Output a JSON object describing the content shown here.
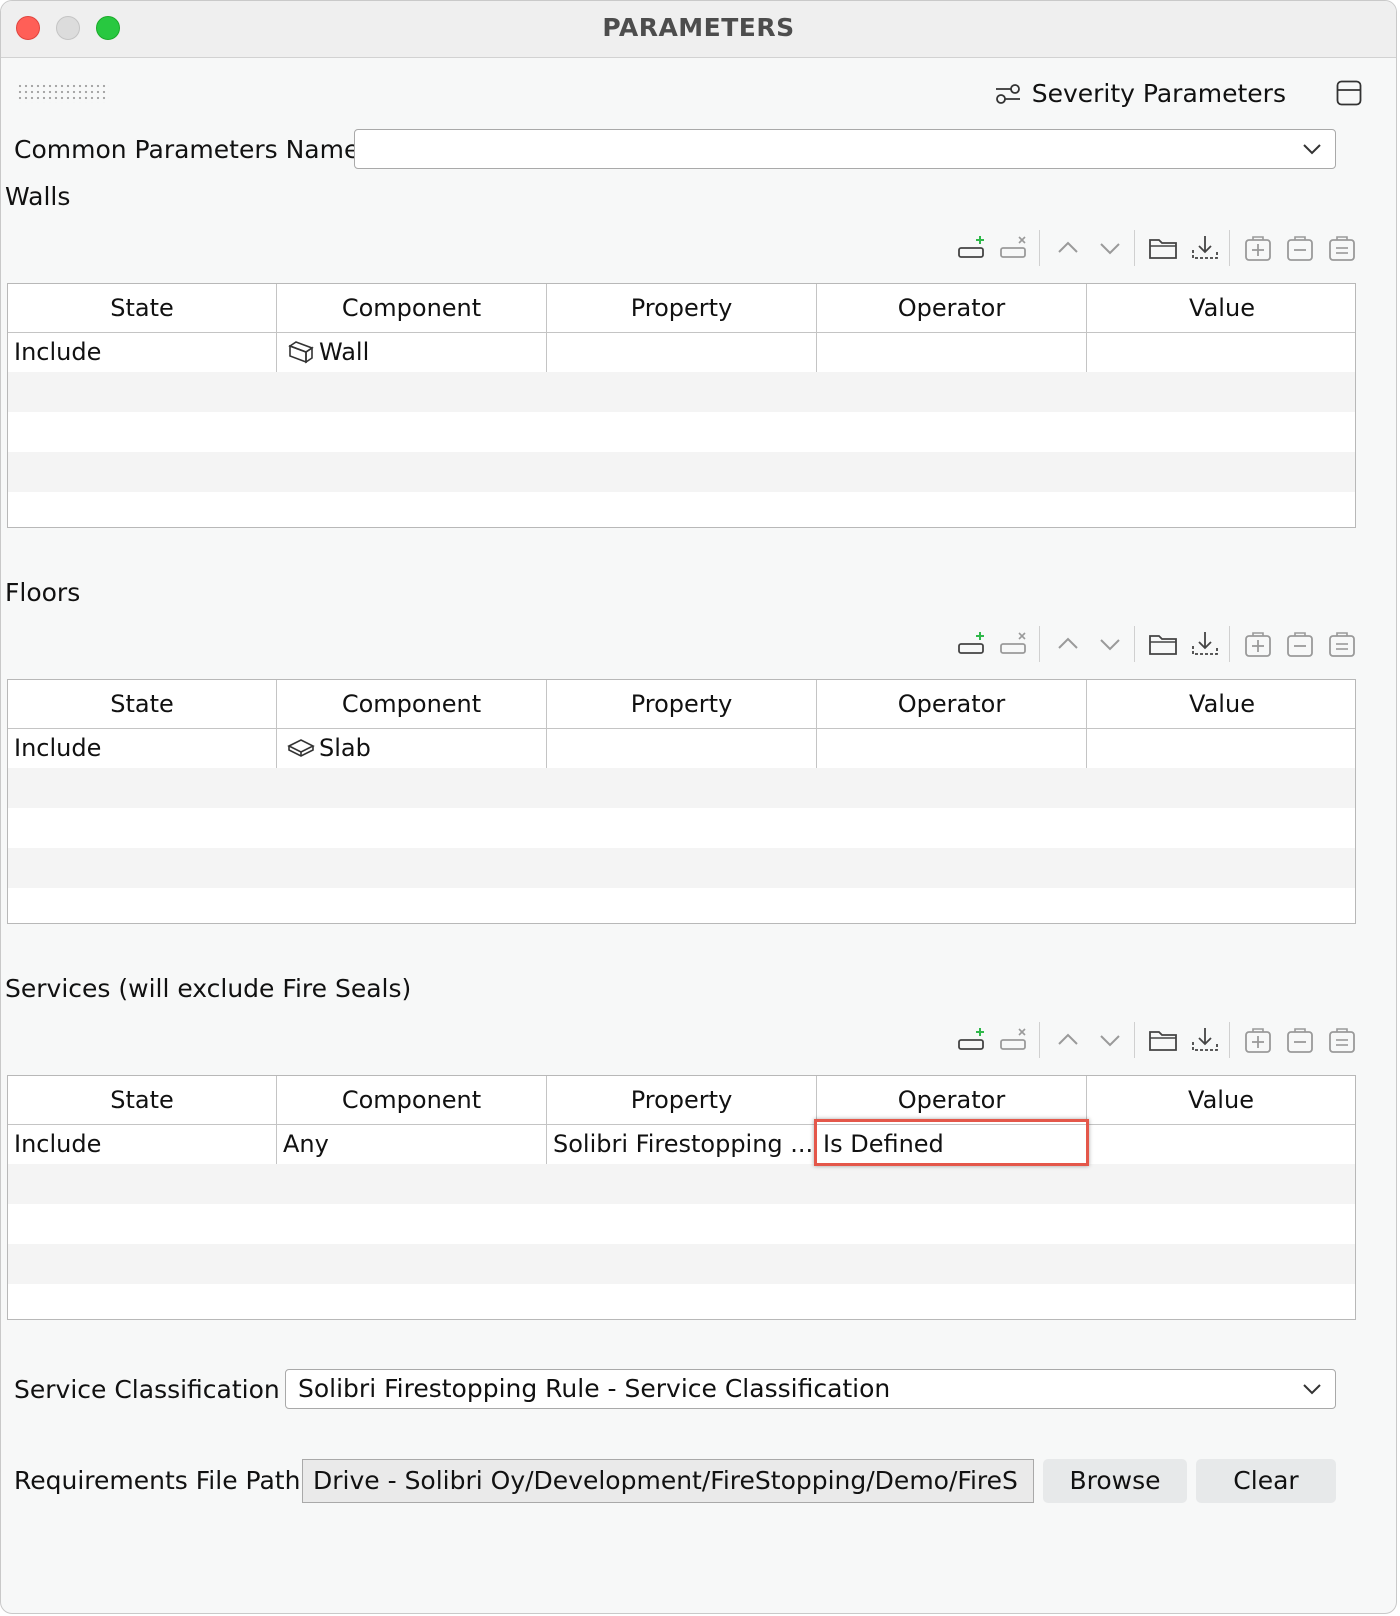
{
  "window": {
    "title": "PARAMETERS"
  },
  "header": {
    "severity_label": "Severity Parameters",
    "severity_icon": "sliders-icon",
    "panel_icon": "panel-toggle-icon"
  },
  "common": {
    "label": "Common Parameters Name",
    "value": ""
  },
  "columns": [
    "State",
    "Component",
    "Property",
    "Operator",
    "Value"
  ],
  "toolbar_icons": [
    "add-row-icon",
    "remove-row-icon",
    "move-up-icon",
    "move-down-icon",
    "open-folder-icon",
    "download-icon",
    "add-item-icon",
    "edit-item-icon",
    "delete-item-icon"
  ],
  "sections": [
    {
      "title": "Walls",
      "row": {
        "state": "Include",
        "component": "Wall",
        "component_icon": "wall-icon",
        "property": "",
        "operator": "",
        "value": ""
      }
    },
    {
      "title": "Floors",
      "row": {
        "state": "Include",
        "component": "Slab",
        "component_icon": "slab-icon",
        "property": "",
        "operator": "",
        "value": ""
      }
    },
    {
      "title": "Services (will exclude Fire Seals)",
      "row": {
        "state": "Include",
        "component": "Any",
        "property": "Solibri Firestopping ...",
        "operator": "Is Defined",
        "value": ""
      }
    }
  ],
  "service_classification": {
    "label": "Service Classification",
    "value": "Solibri Firestopping Rule - Service Classification"
  },
  "requirements": {
    "label": "Requirements File Path",
    "value": "Drive - Solibri Oy/Development/FireStopping/Demo/FireS",
    "browse_label": "Browse",
    "clear_label": "Clear"
  },
  "colors": {
    "accent_add": "#2fb84a",
    "highlight": "#e4574a"
  }
}
